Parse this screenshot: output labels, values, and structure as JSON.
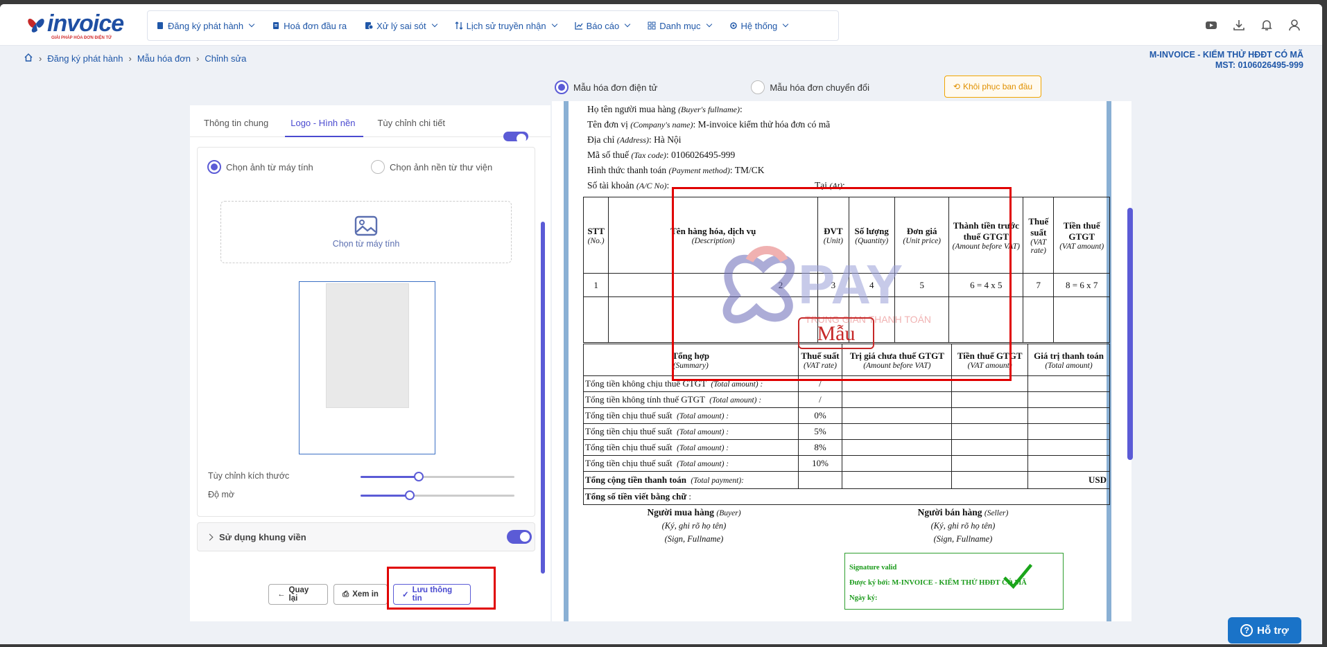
{
  "brand": {
    "logo_text": "invoice",
    "logo_sub": "GIẢI PHÁP HÓA ĐƠN ĐIỆN TỬ"
  },
  "nav": [
    {
      "label": "Đăng ký phát hành",
      "icon": "file-icon"
    },
    {
      "label": "Hoá đơn đầu ra",
      "icon": "invoice-icon"
    },
    {
      "label": "Xử lý sai sót",
      "icon": "error-file-icon"
    },
    {
      "label": "Lịch sử truyền nhận",
      "icon": "transfer-icon"
    },
    {
      "label": "Báo cáo",
      "icon": "chart-icon"
    },
    {
      "label": "Danh mục",
      "icon": "grid-icon"
    },
    {
      "label": "Hệ thống",
      "icon": "gear-icon"
    }
  ],
  "breadcrumb": [
    "Đăng ký phát hành",
    "Mẫu hóa đơn",
    "Chỉnh sửa"
  ],
  "company": {
    "name": "M-INVOICE - KIỂM THỬ HĐĐT CÓ MÃ",
    "mst": "MST: 0106026495-999"
  },
  "template_type": {
    "option1": "Mẫu hóa đơn điện tử",
    "option2": "Mẫu hóa đơn chuyển đổi",
    "selected": "option1"
  },
  "restore_label": "Khôi phục ban đầu",
  "left_tabs": {
    "tab1": "Thông tin chung",
    "tab2": "Logo - Hình nền",
    "tab3": "Tùy chỉnh chi tiết",
    "active": "tab2"
  },
  "bg_source": {
    "opt1": "Chọn ảnh từ máy tính",
    "opt2": "Chọn ảnh nền từ thư viện",
    "selected": "opt1"
  },
  "upload_label": "Chọn từ máy tính",
  "size_label": "Tùy chỉnh kích thước",
  "size_value": 0.38,
  "opacity_label": "Độ mờ",
  "opacity_value": 0.32,
  "frame_label": "Sử dụng khung viền",
  "buttons": {
    "back": "Quay lại",
    "preview": "Xem in",
    "save": "Lưu thông tin"
  },
  "invoice": {
    "buyer_name": {
      "label": "Họ tên người mua hàng",
      "en": "(Buyer's fullname)",
      "value": ""
    },
    "company": {
      "label": "Tên đơn vị",
      "en": "(Company's name)",
      "value": "M-invoice kiểm thử hóa đơn có mã"
    },
    "address": {
      "label": "Địa chỉ",
      "en": "(Address)",
      "value": "Hà Nội"
    },
    "tax": {
      "label": "Mã số thuế",
      "en": "(Tax code)",
      "value": "0106026495-999"
    },
    "payment": {
      "label": "Hình thức thanh toán",
      "en": "(Payment method)",
      "value": "TM/CK"
    },
    "account": {
      "label": "Số tài khoản",
      "en": "(A/C No)",
      "value": ""
    },
    "at": {
      "label": "Tại",
      "en": "(At)",
      "value": ""
    },
    "columns": [
      {
        "vi": "STT",
        "en": "(No.)"
      },
      {
        "vi": "Tên hàng hóa, dịch vụ",
        "en": "(Description)"
      },
      {
        "vi": "ĐVT",
        "en": "(Unit)"
      },
      {
        "vi": "Số lượng",
        "en": "(Quantity)"
      },
      {
        "vi": "Đơn giá",
        "en": "(Unit price)"
      },
      {
        "vi": "Thành tiền trước thuế GTGT",
        "en": "(Amount before VAT)"
      },
      {
        "vi": "Thuế suất",
        "en": "(VAT rate)"
      },
      {
        "vi": "Tiền thuế GTGT",
        "en": "(VAT amount)"
      }
    ],
    "index_row": [
      "1",
      "2",
      "3",
      "4",
      "5",
      "6 = 4 x 5",
      "7",
      "8 = 6 x 7"
    ],
    "summary_cols": [
      {
        "vi": "Tổng hợp",
        "en": "(Summary)"
      },
      {
        "vi": "Thuế suất",
        "en": "(VAT rate)"
      },
      {
        "vi": "Trị giá chưa thuế GTGT",
        "en": "(Amount before VAT)"
      },
      {
        "vi": "Tiền thuế GTGT",
        "en": "(VAT amount)"
      },
      {
        "vi": "Giá trị thanh toán",
        "en": "(Total amount)"
      }
    ],
    "summary_rows": [
      {
        "label": "Tổng tiền không chịu thuế GTGT",
        "en": "(Total amount) :",
        "rate": "/"
      },
      {
        "label": "Tổng tiền không tính thuế GTGT",
        "en": "(Total amount) :",
        "rate": "/"
      },
      {
        "label": "Tổng tiền chịu thuế suất",
        "en": "(Total amount) :",
        "rate": "0%"
      },
      {
        "label": "Tổng tiền chịu thuế suất",
        "en": "(Total amount) :",
        "rate": "5%"
      },
      {
        "label": "Tổng tiền chịu thuế suất",
        "en": "(Total amount) :",
        "rate": "8%"
      },
      {
        "label": "Tổng tiền chịu thuế suất",
        "en": "(Total amount) :",
        "rate": "10%"
      }
    ],
    "total_payment": {
      "label": "Tổng cộng tiền thanh toán",
      "en": "(Total payment):",
      "currency": "USD"
    },
    "in_words": {
      "label": "Tổng số tiền viết bằng chữ",
      "suffix": ":"
    },
    "buyer_sign": {
      "title": "Người mua hàng",
      "en": "(Buyer)",
      "line1": "(Ký, ghi rõ họ tên)",
      "line2": "(Sign, Fullname)"
    },
    "seller_sign": {
      "title": "Người bán hàng",
      "en": "(Seller)",
      "line1": "(Ký, ghi rõ họ tên)",
      "line2": "(Sign, Fullname)"
    },
    "signature": {
      "valid": "Signature valid",
      "signed_by": "Được ký bởi: M-INVOICE - KIỂM THỬ HĐĐT CÓ MÃ",
      "date": "Ngày ký:"
    },
    "watermark_text": "PAY",
    "watermark_sub": "TRUNG GIAN THANH TOÁN",
    "stamp_text": "Mẫu"
  },
  "help_label": "Hỗ trợ",
  "colors": {
    "primary": "#1f57a8",
    "accent": "#5b5bd6",
    "highlight": "#e00000",
    "restore": "#f0a500"
  }
}
